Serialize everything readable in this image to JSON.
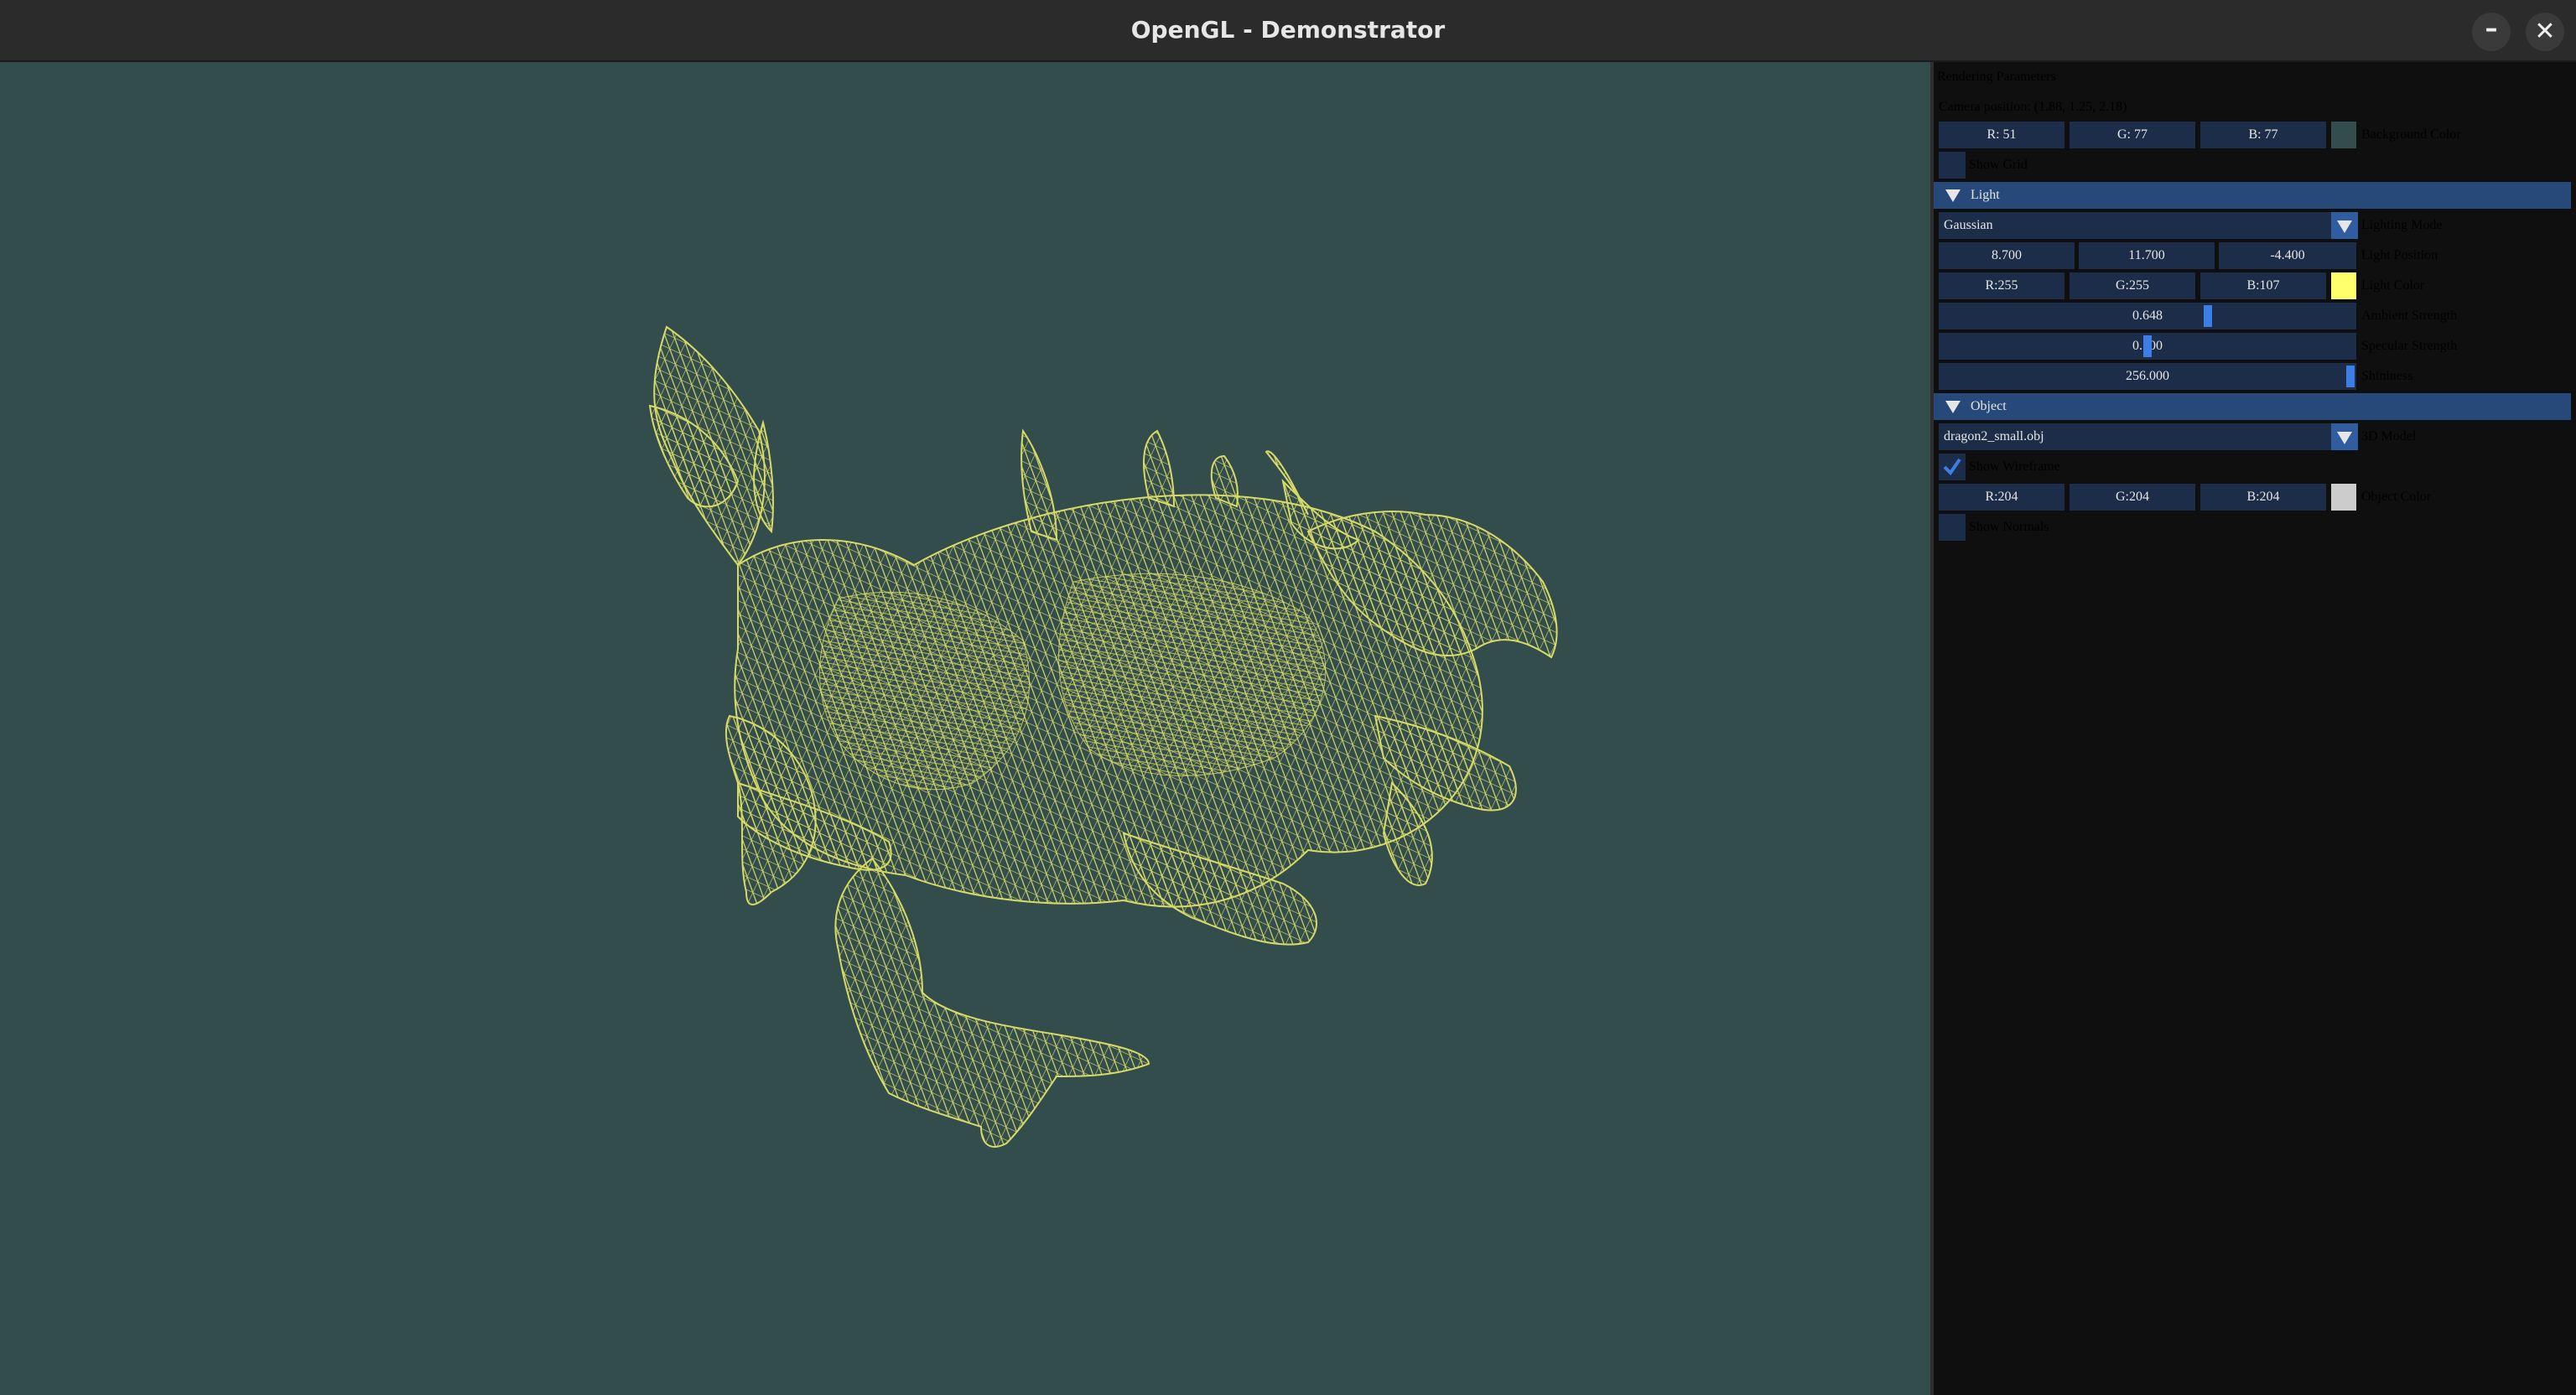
{
  "window": {
    "title": "OpenGL - Demonstrator",
    "minimize_glyph": "–",
    "close_glyph": "✕"
  },
  "viewport": {
    "background_color": "#334d4d",
    "wire_color": "#e6e66a",
    "model_description_icon": "dragon-wireframe"
  },
  "panel": {
    "heading": "Rendering Parameters",
    "camera_label": "Camera position: (1.88, 1.25, 2.18)",
    "background": {
      "r": "R: 51",
      "g": "G: 77",
      "b": "B: 77",
      "label": "Background Color",
      "color": "#334d4d"
    },
    "show_grid": {
      "label": "Show Grid",
      "checked": false
    },
    "light": {
      "header": "Light",
      "mode": {
        "value": "Gaussian",
        "label": "Lighting Mode"
      },
      "position": {
        "x": "8.700",
        "y": "11.700",
        "z": "-4.400",
        "label": "Light Position"
      },
      "color": {
        "r": "R:255",
        "g": "G:255",
        "b": "B:107",
        "label": "Light Color",
        "swatch": "#ffff6b"
      },
      "ambient": {
        "value": "0.648",
        "label": "Ambient Strength",
        "fraction": 0.648
      },
      "specular": {
        "value": "0.500",
        "label": "Specular Strength",
        "fraction": 0.5
      },
      "shininess": {
        "value": "256.000",
        "label": "Shininess",
        "fraction": 1.0
      }
    },
    "object": {
      "header": "Object",
      "model": {
        "value": "dragon2_small.obj",
        "label": "3D Model"
      },
      "show_wireframe": {
        "label": "Show Wireframe",
        "checked": true
      },
      "color": {
        "r": "R:204",
        "g": "G:204",
        "b": "B:204",
        "label": "Object Color",
        "swatch": "#cccccc"
      },
      "show_normals": {
        "label": "Show Normals",
        "checked": false
      }
    }
  },
  "colors": {
    "panel_bg": "#0f0f0f",
    "field_bg": "#1c2d4a",
    "header_bg": "#26497a",
    "accent": "#3d7ee6"
  }
}
